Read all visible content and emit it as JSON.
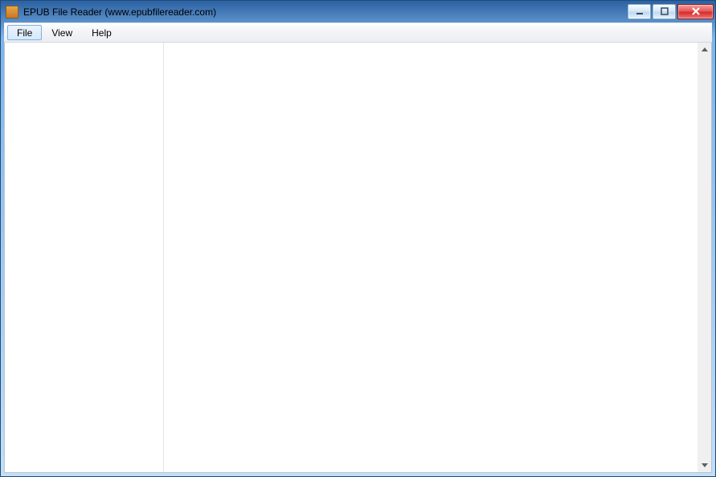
{
  "window": {
    "title": "EPUB File Reader (www.epubfilereader.com)"
  },
  "menu": {
    "file": "File",
    "view": "View",
    "help": "Help"
  }
}
